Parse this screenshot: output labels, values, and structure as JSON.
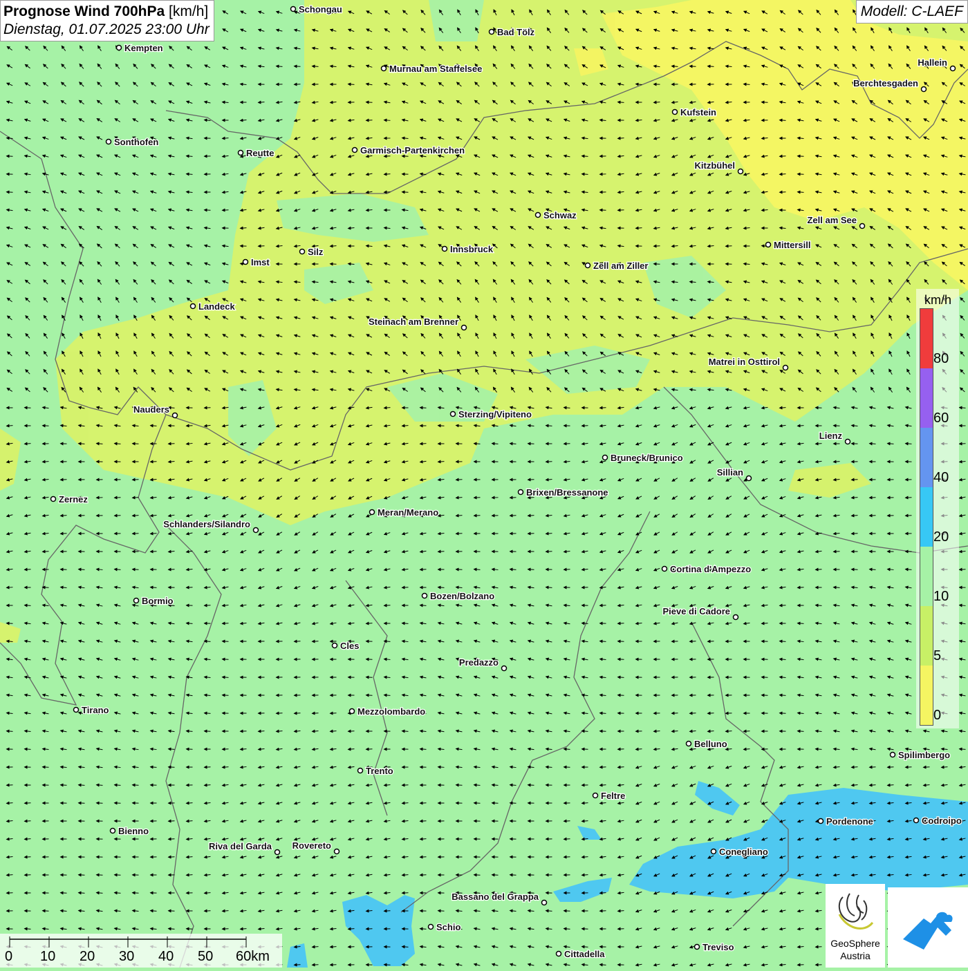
{
  "header": {
    "title_bold": "Prognose Wind 700hPa",
    "title_unit": " [km/h]",
    "subtitle": "Dienstag, 01.07.2025 23:00 Uhr"
  },
  "model_label": "Modell: C-LAEF",
  "legend": {
    "unit": "km/h",
    "ticks": [
      "0",
      "5",
      "10",
      "20",
      "40",
      "60",
      "80"
    ],
    "colors": [
      "#f5f562",
      "#c8f066",
      "#a6f2a6",
      "#37c8f5",
      "#6495f0",
      "#9660f0",
      "#f03c3c"
    ]
  },
  "scale": {
    "labels": [
      "0",
      "10",
      "20",
      "30",
      "40",
      "50",
      "60km"
    ]
  },
  "logo": {
    "name": "GeoSphere",
    "sub": "Austria"
  },
  "background_colors": {
    "calm": "#f5f562",
    "light": "#d8f26a",
    "moderate": "#a6f2a6",
    "strong": "#4fc8f0"
  },
  "cities": [
    {
      "name": "Schongau"
    },
    {
      "name": "Bad Tölz"
    },
    {
      "name": "Kempten"
    },
    {
      "name": "Murnau am Staffelsee"
    },
    {
      "name": "Hallein"
    },
    {
      "name": "Berchtesgaden"
    },
    {
      "name": "Kufstein"
    },
    {
      "name": "Sonthofen"
    },
    {
      "name": "Reutte"
    },
    {
      "name": "Garmisch-Partenkirchen"
    },
    {
      "name": "Kitzbühel"
    },
    {
      "name": "Schwaz"
    },
    {
      "name": "Zell am See"
    },
    {
      "name": "Mittersill"
    },
    {
      "name": "Silz"
    },
    {
      "name": "Innsbruck"
    },
    {
      "name": "Imst"
    },
    {
      "name": "Zell am Ziller"
    },
    {
      "name": "Landeck"
    },
    {
      "name": "Steinach am Brenner"
    },
    {
      "name": "Matrei in Osttirol"
    },
    {
      "name": "Nauders"
    },
    {
      "name": "Sterzing/Vipiteno"
    },
    {
      "name": "Lienz"
    },
    {
      "name": "Bruneck/Brunico"
    },
    {
      "name": "Sillian"
    },
    {
      "name": "Zernez"
    },
    {
      "name": "Brixen/Bressanone"
    },
    {
      "name": "Meran/Merano"
    },
    {
      "name": "Schlanders/Silandro"
    },
    {
      "name": "Cortina d'Ampezzo"
    },
    {
      "name": "Bormio"
    },
    {
      "name": "Bozen/Bolzano"
    },
    {
      "name": "Pieve di Cadore"
    },
    {
      "name": "Cles"
    },
    {
      "name": "Predazzo"
    },
    {
      "name": "Tirano"
    },
    {
      "name": "Mezzolombardo"
    },
    {
      "name": "Belluno"
    },
    {
      "name": "Spilimbergo"
    },
    {
      "name": "Trento"
    },
    {
      "name": "Feltre"
    },
    {
      "name": "Pordenone"
    },
    {
      "name": "Codroipo"
    },
    {
      "name": "Bienno"
    },
    {
      "name": "Riva del Garda"
    },
    {
      "name": "Rovereto"
    },
    {
      "name": "Conegliano"
    },
    {
      "name": "Bassano del Grappa"
    },
    {
      "name": "Schio"
    },
    {
      "name": "Treviso"
    },
    {
      "name": "Cittadella"
    }
  ]
}
